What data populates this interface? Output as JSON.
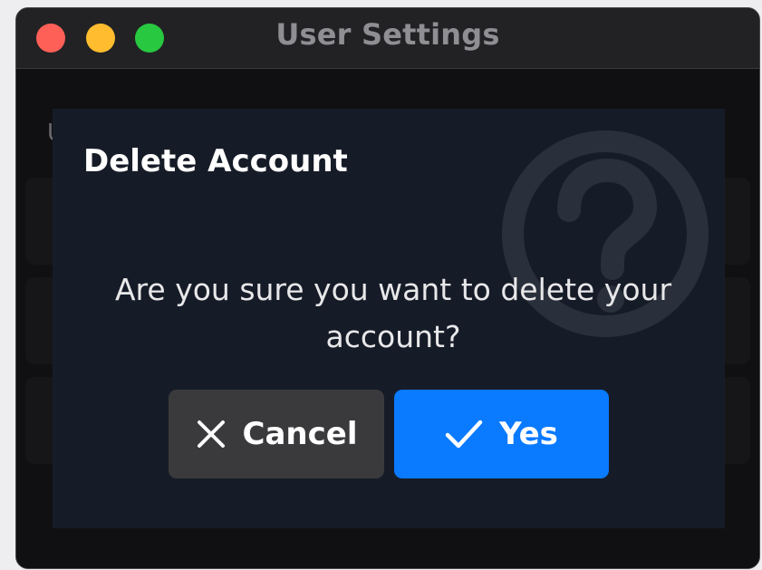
{
  "window": {
    "title": "User Settings",
    "background_label": "U"
  },
  "dialog": {
    "title": "Delete Account",
    "message": "Are you sure you want to delete your account?",
    "icon": "question-circle-icon"
  },
  "buttons": {
    "cancel": {
      "label": "Cancel",
      "icon": "x-icon"
    },
    "yes": {
      "label": "Yes",
      "icon": "checkmark-icon"
    }
  },
  "colors": {
    "dialog_background": "#161c27",
    "yes_button": "#0a7aff",
    "cancel_button": "#3a3a3c",
    "close": "#fe5f57",
    "minimize": "#febc2e",
    "maximize": "#28c840"
  }
}
